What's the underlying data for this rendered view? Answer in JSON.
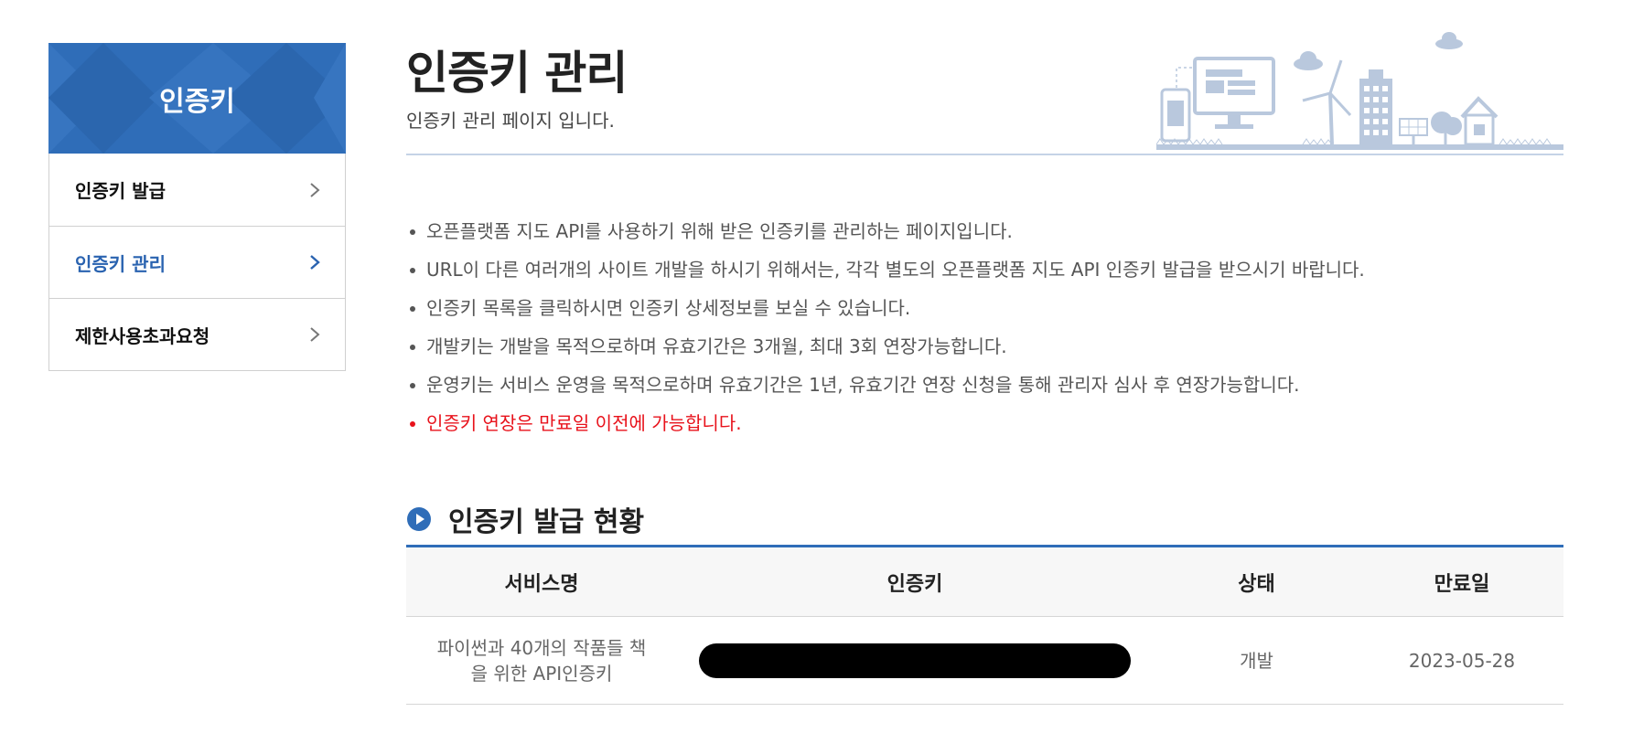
{
  "sidebar": {
    "title": "인증키",
    "items": [
      {
        "label": "인증키 발급",
        "active": false
      },
      {
        "label": "인증키 관리",
        "active": true
      },
      {
        "label": "제한사용초과요청",
        "active": false
      }
    ]
  },
  "header": {
    "title": "인증키 관리",
    "subtitle": "인증키 관리 페이지 입니다."
  },
  "notes": [
    "오픈플랫폼 지도 API를 사용하기 위해 받은 인증키를 관리하는 페이지입니다.",
    "URL이 다른 여러개의 사이트 개발을 하시기 위해서는, 각각 별도의 오픈플랫폼 지도 API 인증키 발급을 받으시기 바랍니다.",
    "인증키 목록을 클릭하시면 인증키 상세정보를 보실 수 있습니다.",
    "개발키는 개발을 목적으로하며 유효기간은 3개월, 최대 3회 연장가능합니다.",
    "운영키는 서비스 운영을 목적으로하며 유효기간은 1년, 유효기간 연장 신청을 통해 관리자 심사 후 연장가능합니다.",
    "인증키 연장은 만료일 이전에 가능합니다."
  ],
  "section": {
    "title": "인증키 발급 현황",
    "icon": "circle-play-icon"
  },
  "table": {
    "columns": [
      "서비스명",
      "인증키",
      "상태",
      "만료일"
    ],
    "rows": [
      {
        "service_line1": "파이썬과 40개의 작품들 책",
        "service_line2": "을 위한 API인증키",
        "status": "개발",
        "expiry": "2023-05-28"
      }
    ]
  },
  "colors": {
    "brand_blue": "#2f6db8",
    "active_text": "#2a63b0",
    "warning_red": "#e8121b",
    "illustration": "#b9c8dd"
  }
}
